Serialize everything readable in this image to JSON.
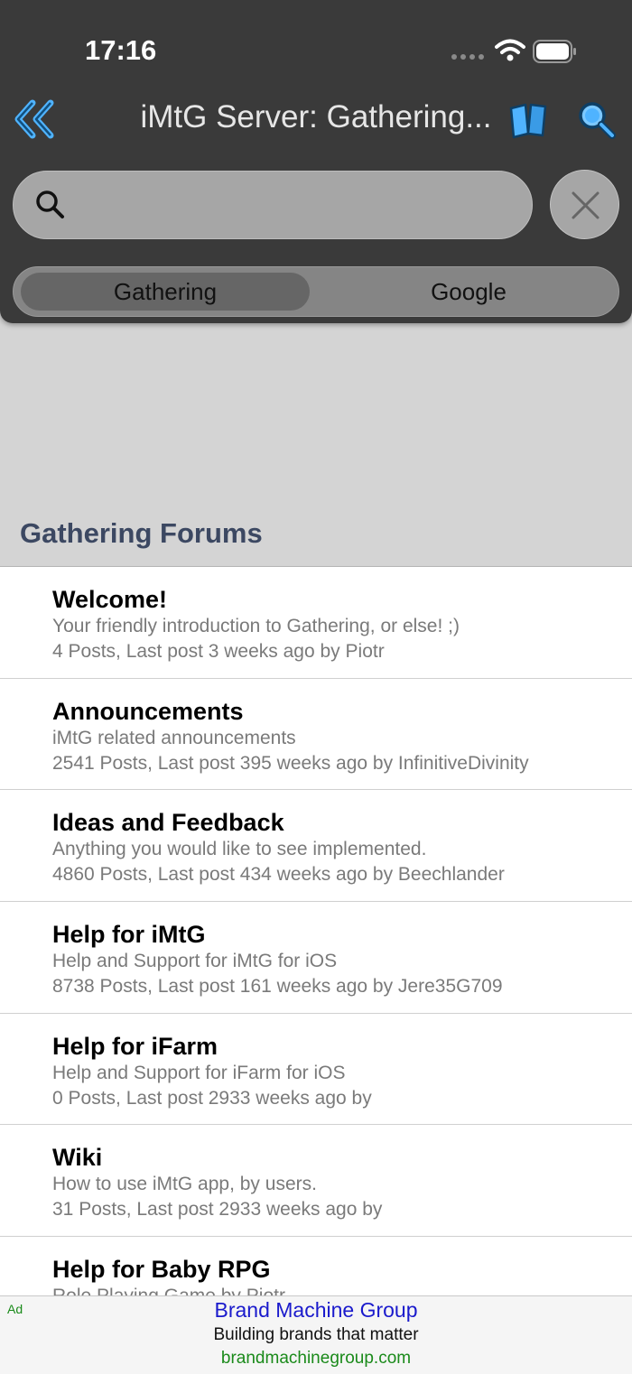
{
  "status_bar": {
    "time": "17:16"
  },
  "nav": {
    "title": "iMtG Server: Gathering..."
  },
  "search": {
    "placeholder": "",
    "value": ""
  },
  "segments": [
    {
      "label": "Gathering",
      "selected": true
    },
    {
      "label": "Google",
      "selected": false
    }
  ],
  "section": {
    "title": "Gathering Forums"
  },
  "forums": [
    {
      "title": "Welcome!",
      "description": "Your friendly introduction to Gathering, or else! ;)",
      "meta": "4 Posts, Last post 3 weeks ago by Piotr"
    },
    {
      "title": "Announcements",
      "description": "iMtG related announcements",
      "meta": "2541 Posts, Last post 395 weeks ago by InfinitiveDivinity"
    },
    {
      "title": "Ideas and Feedback",
      "description": "Anything you would like to see implemented.",
      "meta": "4860 Posts, Last post 434 weeks ago by Beechlander"
    },
    {
      "title": "Help for iMtG",
      "description": "Help and Support for iMtG for iOS",
      "meta": "8738 Posts, Last post 161 weeks ago by Jere35G709"
    },
    {
      "title": "Help for iFarm",
      "description": "Help and Support for iFarm for iOS",
      "meta": "0 Posts, Last post 2933 weeks ago by"
    },
    {
      "title": "Wiki",
      "description": "How to use iMtG app, by users.",
      "meta": "31 Posts, Last post 2933 weeks ago by"
    },
    {
      "title": "Help for Baby RPG",
      "description": "Role Playing Game by Piotr",
      "meta": ""
    }
  ],
  "ad": {
    "tag": "Ad",
    "title": "Brand Machine Group",
    "description": "Building brands that matter",
    "url": "brandmachinegroup.com"
  },
  "colors": {
    "topbar": "#3a3a3a",
    "accent_icon": "#1e7fd0",
    "section_header": "#3c4862",
    "ad_title": "#1a1acc",
    "ad_url": "#1a8a1a"
  },
  "icons": [
    "chevron-double-left-icon",
    "book-icon",
    "search-icon",
    "close-icon",
    "wifi-icon",
    "battery-icon"
  ]
}
